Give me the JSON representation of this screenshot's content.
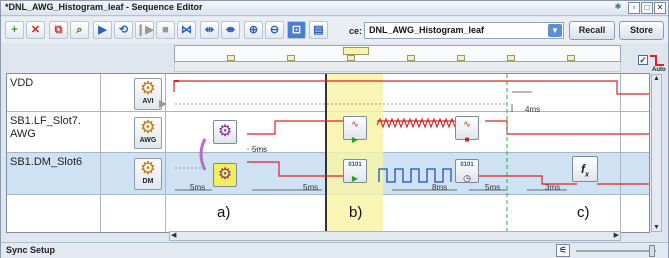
{
  "window": {
    "title": "*DNL_AWG_Histogram_leaf - Sequence Editor"
  },
  "toolbar": {
    "sequence_label": "ce:",
    "sequence_value": "DNL_AWG_Histogram_leaf",
    "recall_label": "Recall",
    "store_label": "Store",
    "auto_label": "Auto"
  },
  "tracks": [
    {
      "label": "VDD",
      "icon_label": "AVI"
    },
    {
      "label": "SB1.LF_Slot7.\nAWG",
      "icon_label": "AWG"
    },
    {
      "label": "SB1.DM_Slot6",
      "icon_label": "DM"
    }
  ],
  "timing": {
    "vdd_4ms": "4ms",
    "awg_5ms": "5ms",
    "dm_5ms_a": "5ms",
    "dm_5ms_b": "5ms",
    "dm_8ms": "8ms",
    "dm_5ms_c": "5ms",
    "dm_3ms": "3ms"
  },
  "phases": {
    "a": "a)",
    "b": "b)",
    "c": "c)"
  },
  "blocks": {
    "digital_label": "0101"
  },
  "status": {
    "label": "Sync Setup"
  },
  "colors": {
    "signal": "#e02020",
    "highlight": "#f7f3a8",
    "dm_row": "#cfe2f3"
  }
}
